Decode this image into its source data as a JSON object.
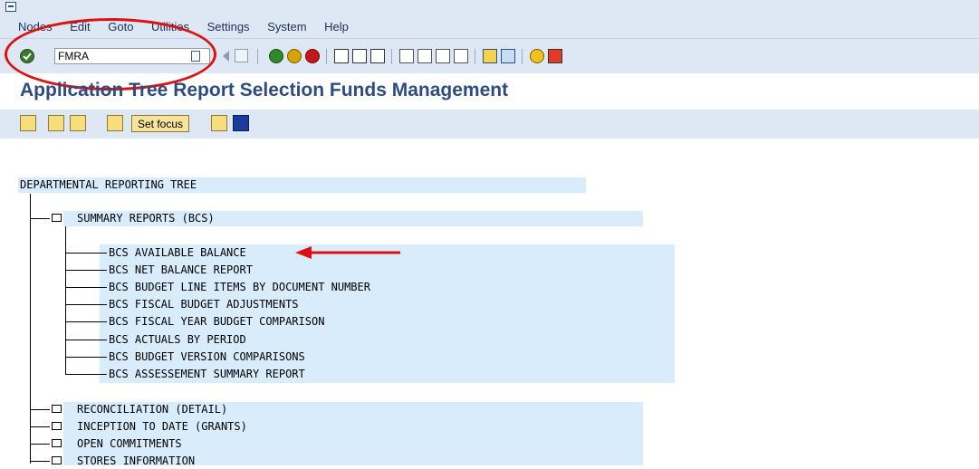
{
  "menu": {
    "items": [
      "Nodes",
      "Edit",
      "Goto",
      "Utilities",
      "Settings",
      "System",
      "Help"
    ]
  },
  "toolbar": {
    "command_value": "FMRA"
  },
  "page": {
    "title": "Application Tree Report Selection Funds Management"
  },
  "app_toolbar": {
    "set_focus_label": "Set focus"
  },
  "tree": {
    "root": "DEPARTMENTAL REPORTING TREE",
    "summary_node": "SUMMARY REPORTS (BCS)",
    "summary_reports": [
      "BCS AVAILABLE BALANCE",
      "BCS NET BALANCE REPORT",
      "BCS BUDGET LINE ITEMS BY DOCUMENT NUMBER",
      "BCS FISCAL BUDGET ADJUSTMENTS",
      "BCS FISCAL YEAR BUDGET COMPARISON",
      "BCS ACTUALS BY PERIOD",
      "BCS BUDGET VERSION COMPARISONS",
      "BCS ASSESSEMENT SUMMARY REPORT"
    ],
    "other_nodes": [
      "RECONCILIATION (DETAIL)",
      "INCEPTION TO DATE (GRANTS)",
      "OPEN COMMITMENTS",
      "STORES INFORMATION"
    ]
  },
  "colors": {
    "highlight": "#d8ecfb",
    "title": "#2d4d82",
    "annotation": "#e01010"
  }
}
